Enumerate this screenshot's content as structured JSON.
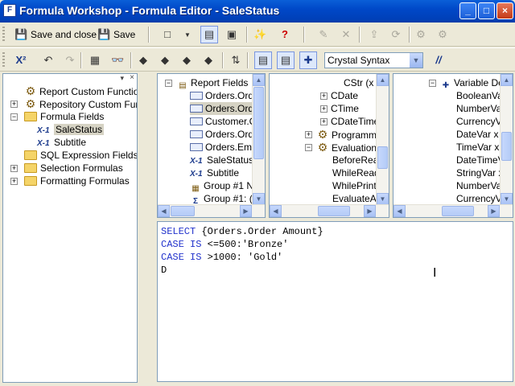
{
  "window": {
    "title": "Formula Workshop - Formula Editor - SaleStatus"
  },
  "toolbar1": {
    "save_and_close": "Save and close",
    "save": "Save",
    "new_icon": "new-icon",
    "help_icon": "help-icon"
  },
  "toolbar2": {
    "syntax_selected": "Crystal Syntax",
    "comment_label": "//"
  },
  "left_tree": {
    "items": [
      {
        "label": "Report Custom Functions"
      },
      {
        "label": "Repository Custom Functi"
      },
      {
        "label": "Formula Fields"
      },
      {
        "label": "SaleStatus"
      },
      {
        "label": "Subtitle"
      },
      {
        "label": "SQL Expression Fields"
      },
      {
        "label": "Selection Formulas"
      },
      {
        "label": "Formatting Formulas"
      }
    ]
  },
  "fields_pane": {
    "items": [
      {
        "label": "Report Fields"
      },
      {
        "label": "Orders.Orde"
      },
      {
        "label": "Orders.Orde"
      },
      {
        "label": "Customer.C"
      },
      {
        "label": "Orders.Orde"
      },
      {
        "label": "Orders.Emp"
      },
      {
        "label": "SaleStatus"
      },
      {
        "label": "Subtitle"
      },
      {
        "label": "Group #1 N"
      },
      {
        "label": "Group #1: ("
      }
    ]
  },
  "functions_pane": {
    "items": [
      {
        "label": "CStr (x"
      },
      {
        "label": "CDate"
      },
      {
        "label": "CTime"
      },
      {
        "label": "CDateTime"
      },
      {
        "label": "Programmin"
      },
      {
        "label": "Evaluation"
      },
      {
        "label": "BeforeRea"
      },
      {
        "label": "WhileRead"
      },
      {
        "label": "WhilePrinti"
      },
      {
        "label": "EvaluateA"
      }
    ]
  },
  "operators_pane": {
    "items": [
      {
        "label": "Variable De"
      },
      {
        "label": "BooleanVa"
      },
      {
        "label": "NumberVa"
      },
      {
        "label": "CurrencyV"
      },
      {
        "label": "DateVar x"
      },
      {
        "label": "TimeVar x"
      },
      {
        "label": "DateTimeV"
      },
      {
        "label": "StringVar x"
      },
      {
        "label": "NumberVa"
      },
      {
        "label": "CurrencyVa"
      }
    ]
  },
  "editor": {
    "lines": [
      {
        "kw": "SELECT",
        "rest": " {Orders.Order Amount}"
      },
      {
        "kw": "CASE IS",
        "rest": " <=500:'Bronze'"
      },
      {
        "kw": "CASE IS",
        "rest": " >1000: 'Gold'"
      },
      {
        "kw": "",
        "rest": "D"
      }
    ]
  }
}
